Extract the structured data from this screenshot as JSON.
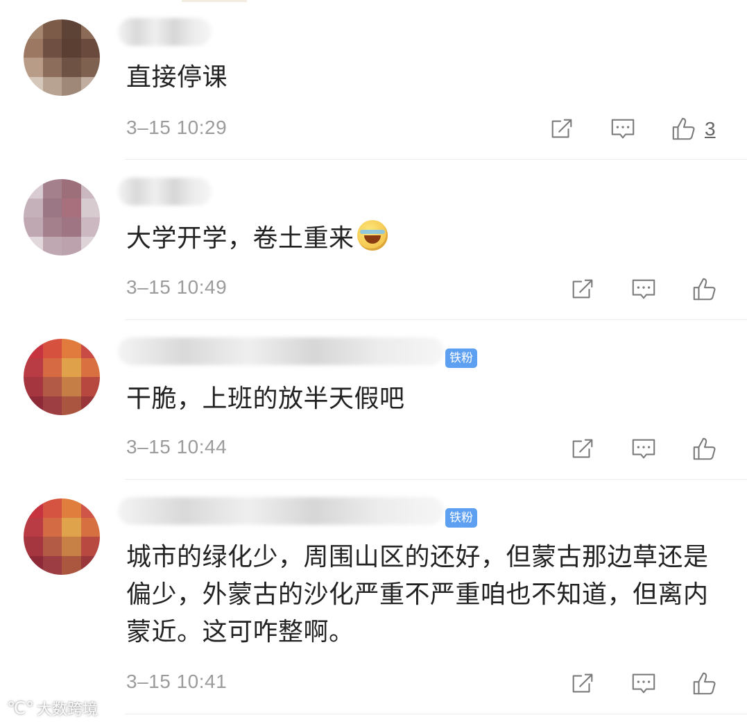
{
  "comments": [
    {
      "text": "直接停课",
      "time": "3–15 10:29",
      "like_count": "3",
      "has_emoji": false,
      "badge": null,
      "avatar_colors": [
        "#a58770",
        "#7d5b49",
        "#5d4335",
        "#8b6a58",
        "#9c7762",
        "#6f4f41",
        "#5b3f33",
        "#6a4a3c",
        "#b89c88",
        "#8c6d5c",
        "#6e5244",
        "#7f6150",
        "#d6c7bb",
        "#b8a292",
        "#a08878",
        "#c0ad9f"
      ]
    },
    {
      "text": "大学开学，卷土重来",
      "time": "3–15 10:49",
      "like_count": "",
      "has_emoji": true,
      "badge": null,
      "avatar_colors": [
        "#d8ccd2",
        "#a4808c",
        "#9d6f7a",
        "#cab7bf",
        "#c5b1ba",
        "#9b7684",
        "#a86f7d",
        "#d7cbd0",
        "#bfa8b2",
        "#a47f8c",
        "#9f7483",
        "#cbb8c0",
        "#e2d8dc",
        "#c0a8b2",
        "#bca2ad",
        "#ded3d7"
      ]
    },
    {
      "text": "干脆，上班的放半天假吧",
      "time": "3–15 10:44",
      "like_count": "",
      "has_emoji": false,
      "badge": "铁粉",
      "avatar_colors": [
        "#c6343f",
        "#d7523e",
        "#e07a3d",
        "#c94b45",
        "#b93c45",
        "#d56a43",
        "#dfa24a",
        "#d8703f",
        "#a5353f",
        "#b25a45",
        "#c57f46",
        "#b6483f",
        "#8e2a37",
        "#9d3e42",
        "#a9553f",
        "#98363a"
      ]
    },
    {
      "text": "城市的绿化少，周围山区的还好，但蒙古那边草还是偏少，外蒙古的沙化严重不严重咱也不知道，但离内蒙近。这可咋整啊。",
      "time": "3–15 10:41",
      "like_count": "",
      "has_emoji": false,
      "badge": "铁粉",
      "avatar_colors": [
        "#c6343f",
        "#d55341",
        "#e07e3e",
        "#d05549",
        "#b93c45",
        "#d36b44",
        "#dea34b",
        "#d77040",
        "#a5353f",
        "#b45b45",
        "#c78146",
        "#b74941",
        "#8e2a37",
        "#9b3d42",
        "#ab5740",
        "#99373b"
      ]
    }
  ],
  "icons": {
    "forward": "share-edit-icon",
    "comment": "comment-bubble-icon",
    "like": "thumbs-up-icon"
  },
  "watermark": {
    "text": "大数跨境"
  }
}
